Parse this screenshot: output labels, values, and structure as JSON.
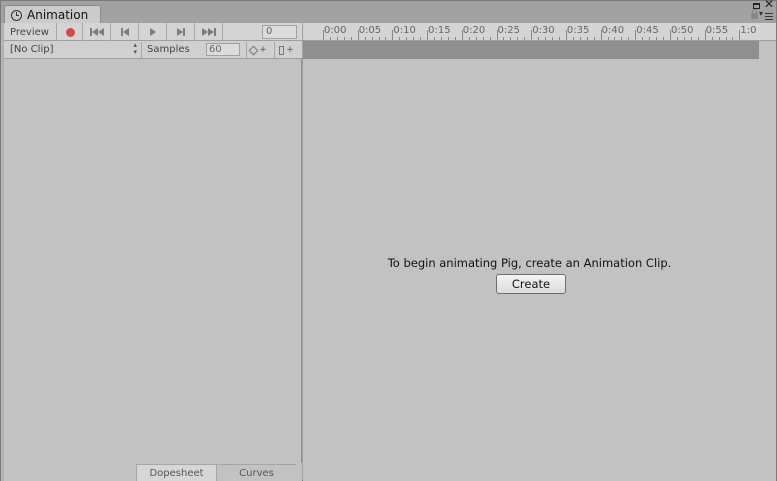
{
  "window": {
    "tab_title": "Animation"
  },
  "toolbar": {
    "preview_label": "Preview",
    "frame_value": "0",
    "clip_selected": "[No Clip]",
    "samples_label": "Samples",
    "samples_value": "60"
  },
  "timeline": {
    "ticks": [
      "0:00",
      "0:05",
      "0:10",
      "0:15",
      "0:20",
      "0:25",
      "0:30",
      "0:35",
      "0:40",
      "0:45",
      "0:50",
      "0:55",
      "1:0"
    ]
  },
  "main": {
    "empty_message": "To begin animating Pig, create an Animation Clip.",
    "create_label": "Create"
  },
  "bottom_tabs": {
    "dopesheet_label": "Dopesheet",
    "curves_label": "Curves"
  },
  "colors": {
    "record_accent": "#d24b4b",
    "panel_bg": "#c2c2c2",
    "event_strip": "#8f8f8f"
  }
}
